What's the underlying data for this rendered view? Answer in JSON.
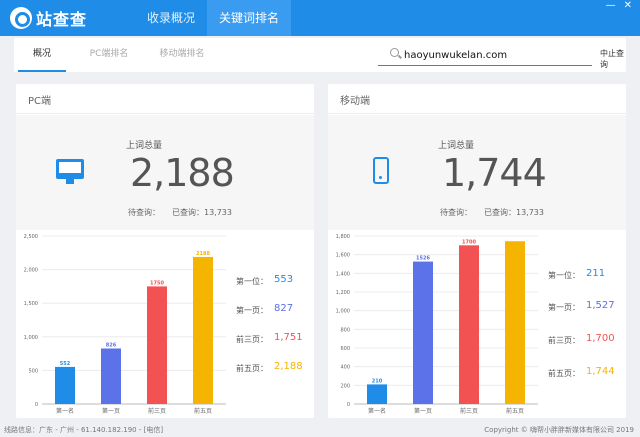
{
  "app": {
    "name": "站查查"
  },
  "nav": {
    "tabs": [
      {
        "label": "收录概况"
      },
      {
        "label": "关键词排名"
      }
    ]
  },
  "window": {
    "minimize": "—",
    "close": "✕"
  },
  "subnav": {
    "tabs": [
      {
        "label": "概况"
      },
      {
        "label": "PC端排名"
      },
      {
        "label": "移动端排名"
      }
    ],
    "search_value": "haoyunwukelan.com",
    "stop_label": "中止查询"
  },
  "pc": {
    "title": "PC端",
    "total_label": "上词总量",
    "total": "2,188",
    "pending": "待查询：",
    "queried": "已查询：13,733",
    "stats": [
      {
        "label": "第一位：",
        "value": "553",
        "color": "#1f8de8"
      },
      {
        "label": "第一页：",
        "value": "827",
        "color": "#5b72e8"
      },
      {
        "label": "前三页：",
        "value": "1,751",
        "color": "#f25252"
      },
      {
        "label": "前五页：",
        "value": "2,188",
        "color": "#f5b400"
      }
    ]
  },
  "mobile": {
    "title": "移动端",
    "total_label": "上词总量",
    "total": "1,744",
    "pending": "待查询：",
    "queried": "已查询：13,733",
    "stats": [
      {
        "label": "第一位：",
        "value": "211",
        "color": "#1f8de8"
      },
      {
        "label": "第一页：",
        "value": "1,527",
        "color": "#5b72e8"
      },
      {
        "label": "前三页：",
        "value": "1,700",
        "color": "#f25252"
      },
      {
        "label": "前五页：",
        "value": "1,744",
        "color": "#f5b400"
      }
    ]
  },
  "chart_data": [
    {
      "type": "bar",
      "categories": [
        "第一名",
        "第一页",
        "前三页",
        "前五页"
      ],
      "values": [
        552,
        826,
        1750,
        2188
      ],
      "value_labels": [
        "552",
        "826",
        "1750",
        "2188"
      ],
      "colors": [
        "#1f8de8",
        "#5b72e8",
        "#f25252",
        "#f5b400"
      ],
      "ylim": [
        0,
        2500
      ],
      "yticks": [
        "0",
        "500",
        "1,000",
        "1,500",
        "2,000",
        "2,500"
      ],
      "ytick_values": [
        0,
        500,
        1000,
        1500,
        2000,
        2500
      ]
    },
    {
      "type": "bar",
      "categories": [
        "第一名",
        "第一页",
        "前三页",
        "前五页"
      ],
      "values": [
        210,
        1526,
        1700,
        1744
      ],
      "value_labels": [
        "210",
        "1526",
        "1700",
        ""
      ],
      "colors": [
        "#1f8de8",
        "#5b72e8",
        "#f25252",
        "#f5b400"
      ],
      "ylim": [
        0,
        1800
      ],
      "yticks": [
        "0",
        "200",
        "400",
        "600",
        "800",
        "1,000",
        "1,200",
        "1,400",
        "1,600",
        "1,800"
      ],
      "ytick_values": [
        0,
        200,
        400,
        600,
        800,
        1000,
        1200,
        1400,
        1600,
        1800
      ]
    }
  ],
  "footer": {
    "left": "线路信息：广东 - 广州 - 61.140.182.190 - [电信]",
    "right": "Copyright © 嗨帮小胖胖新媒体有限公司 2019"
  }
}
